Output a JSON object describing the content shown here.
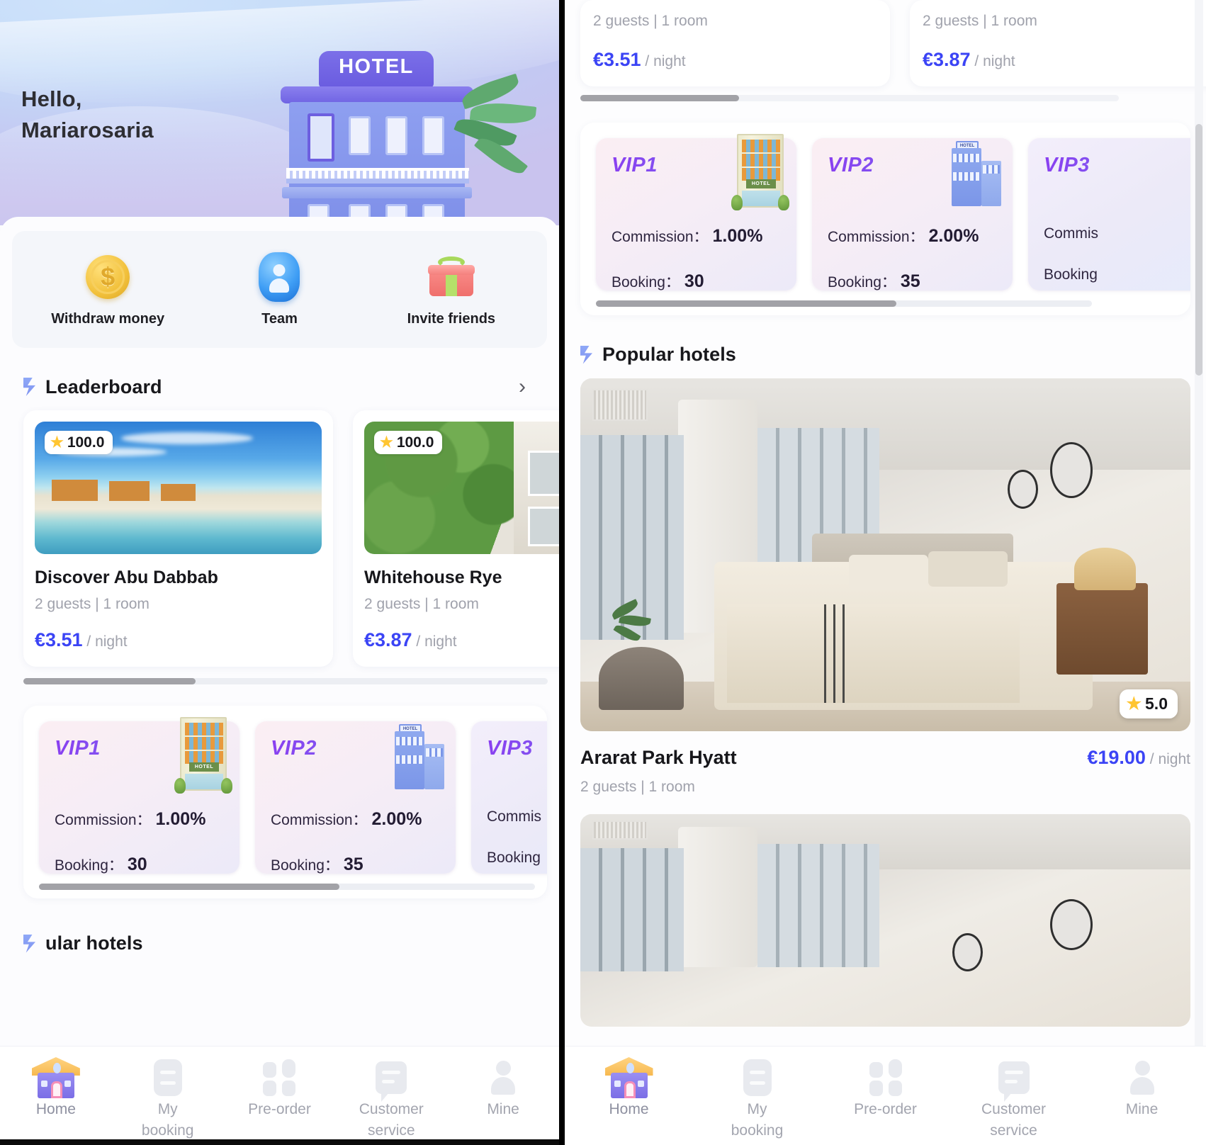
{
  "app": {
    "greeting_line1": "Hello,",
    "greeting_line2": "Mariarosaria"
  },
  "hero": {
    "hotel_sign": "HOTEL"
  },
  "quick_actions": [
    {
      "label": "Withdraw money",
      "icon": "coin-icon"
    },
    {
      "label": "Team",
      "icon": "user-avatar-icon"
    },
    {
      "label": "Invite friends",
      "icon": "gift-icon"
    }
  ],
  "leaderboard": {
    "title": "Leaderboard",
    "chevron": "›",
    "cards": [
      {
        "rating": "100.0",
        "name": "Discover Abu Dabbab",
        "occupancy": "2 guests | 1 room",
        "price": "€3.51",
        "per": "/ night"
      },
      {
        "rating": "100.0",
        "name": "Whitehouse Rye",
        "occupancy": "2 guests | 1 room",
        "price": "€3.87",
        "per": "/ night"
      }
    ]
  },
  "vip_levels": [
    {
      "level": "VIP1",
      "commission_label": "Commission：",
      "commission_value": "1.00%",
      "booking_label": "Booking：",
      "booking_value": "30"
    },
    {
      "level": "VIP2",
      "commission_label": "Commission：",
      "commission_value": "2.00%",
      "booking_label": "Booking：",
      "booking_value": "35"
    },
    {
      "level": "VIP3",
      "commission_label": "Commis",
      "commission_value": "",
      "booking_label": "Booking",
      "booking_value": ""
    }
  ],
  "popular_hotels": {
    "title": "Popular hotels",
    "items": [
      {
        "rating": "5.0",
        "name": "Ararat Park Hyatt",
        "price": "€19.00",
        "per": "/ night",
        "occupancy": "2 guests | 1 room"
      }
    ]
  },
  "popular_hotels_partial_title": "ular hotels",
  "bottom_nav": [
    {
      "label": "Home",
      "icon": "house-icon",
      "active": true
    },
    {
      "label": "My\nbooking",
      "icon": "document-icon",
      "active": false
    },
    {
      "label": "Pre-order",
      "icon": "grid-icon",
      "active": false
    },
    {
      "label": "Customer\nservice",
      "icon": "chat-icon",
      "active": false
    },
    {
      "label": "Mine",
      "icon": "person-icon",
      "active": false
    }
  ],
  "nav_labels": {
    "home": "Home",
    "my_booking_l1": "My",
    "my_booking_l2": "booking",
    "preorder": "Pre-order",
    "customer_l1": "Customer",
    "customer_l2": "service",
    "mine": "Mine"
  },
  "colors": {
    "price_blue": "#3b44f5",
    "star_yellow": "#ffc531",
    "vip_purple": "#8a3ff0",
    "muted": "#a0a2ac"
  }
}
